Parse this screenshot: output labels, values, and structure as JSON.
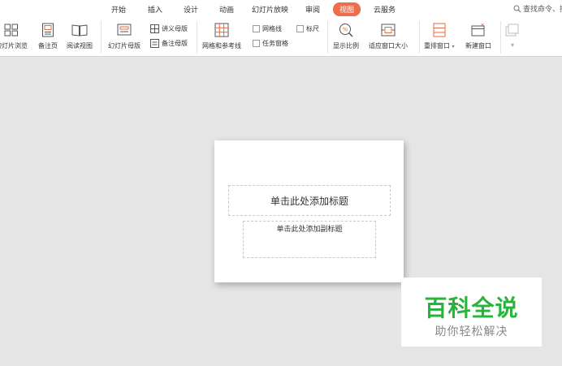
{
  "menu": {
    "tabs": [
      "开始",
      "插入",
      "设计",
      "动画",
      "幻灯片放映",
      "审阅",
      "视图",
      "云服务"
    ],
    "active": "视图",
    "search_text": "查找命令、搜"
  },
  "ribbon": {
    "slide_sorter": "幻灯片浏览",
    "notes_page": "备注页",
    "reading_view": "阅读视图",
    "slide_master": "幻灯片母版",
    "handout_master": "讲义母版",
    "notes_master": "备注母版",
    "grid_guides": "网格和参考线",
    "gridlines": "网格线",
    "ruler": "标尺",
    "task_pane": "任务窗格",
    "zoom": "显示比例",
    "fit_window": "适应窗口大小",
    "arrange_windows": "重排窗口",
    "new_window": "新建窗口"
  },
  "slide": {
    "title_placeholder": "单击此处添加标题",
    "subtitle_placeholder": "单击此处添加副标题"
  },
  "watermark": {
    "brand": "百科全说",
    "tagline": "助你轻松解决"
  },
  "colors": {
    "active_tab": "#ee6d4a",
    "workspace": "#e5e5e5",
    "watermark_green": "#27b43a"
  }
}
